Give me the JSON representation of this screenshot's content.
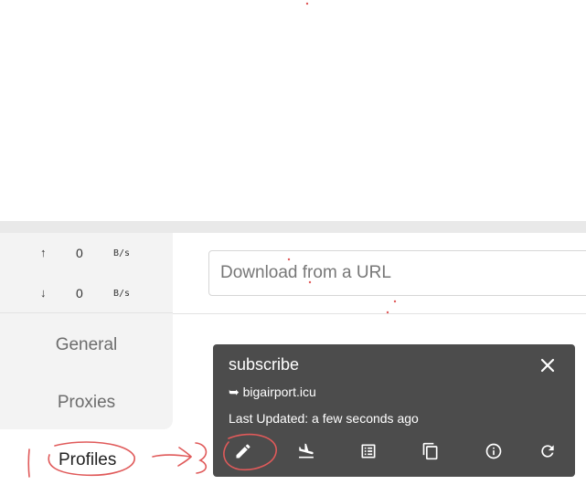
{
  "traffic": {
    "up_arrow": "↑",
    "up_value": "0",
    "up_unit": "B/s",
    "down_arrow": "↓",
    "down_value": "0",
    "down_unit": "B/s"
  },
  "nav": {
    "items": [
      {
        "label": "General"
      },
      {
        "label": "Proxies"
      },
      {
        "label": "Profiles"
      }
    ]
  },
  "url_input": {
    "placeholder": "Download from a URL",
    "value": ""
  },
  "profile_card": {
    "title": "subscribe",
    "host": "➥ bigairport.icu",
    "last_updated": "Last Updated: a few seconds ago",
    "actions": [
      "edit-icon",
      "flight-land-icon",
      "list-icon",
      "copy-icon",
      "info-icon",
      "refresh-icon"
    ],
    "close_icon": "close-icon"
  },
  "colors": {
    "card_background": "#4c4c4c",
    "sidebar_background": "#f3f3f3",
    "annotation_red": "#e05a5a"
  }
}
